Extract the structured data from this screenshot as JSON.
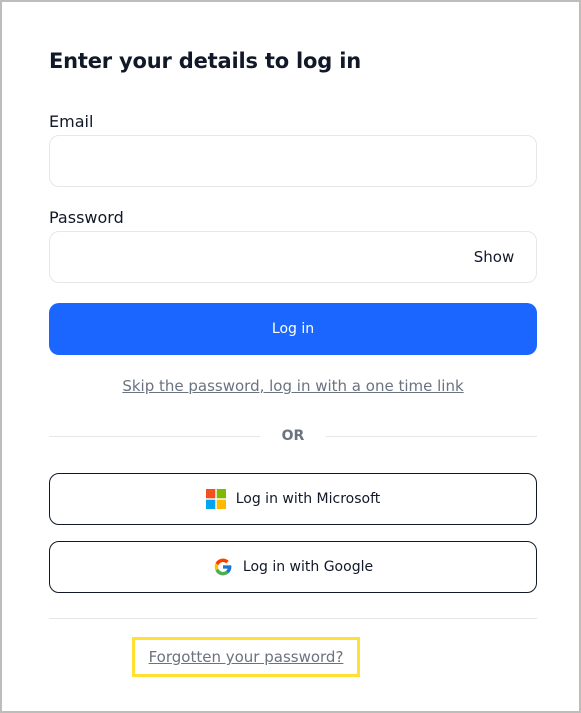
{
  "form": {
    "title": "Enter your details to log in",
    "email": {
      "label": "Email",
      "value": "",
      "placeholder": ""
    },
    "password": {
      "label": "Password",
      "value": "",
      "placeholder": "",
      "toggle_label": "Show"
    },
    "login_button_label": "Log in",
    "magic_link_label": "Skip the password, log in with a one time link",
    "divider_text": "OR",
    "sso": {
      "microsoft_label": "Log in with Microsoft",
      "microsoft_icon": "microsoft-logo-icon",
      "google_label": "Log in with Google",
      "google_icon": "google-logo-icon"
    },
    "forgot_password_label": "Forgotten your password?"
  },
  "colors": {
    "primary": "#1a66ff",
    "highlight_border": "#ffe033",
    "muted_text": "#6b7280",
    "input_border": "#e5e7eb"
  }
}
